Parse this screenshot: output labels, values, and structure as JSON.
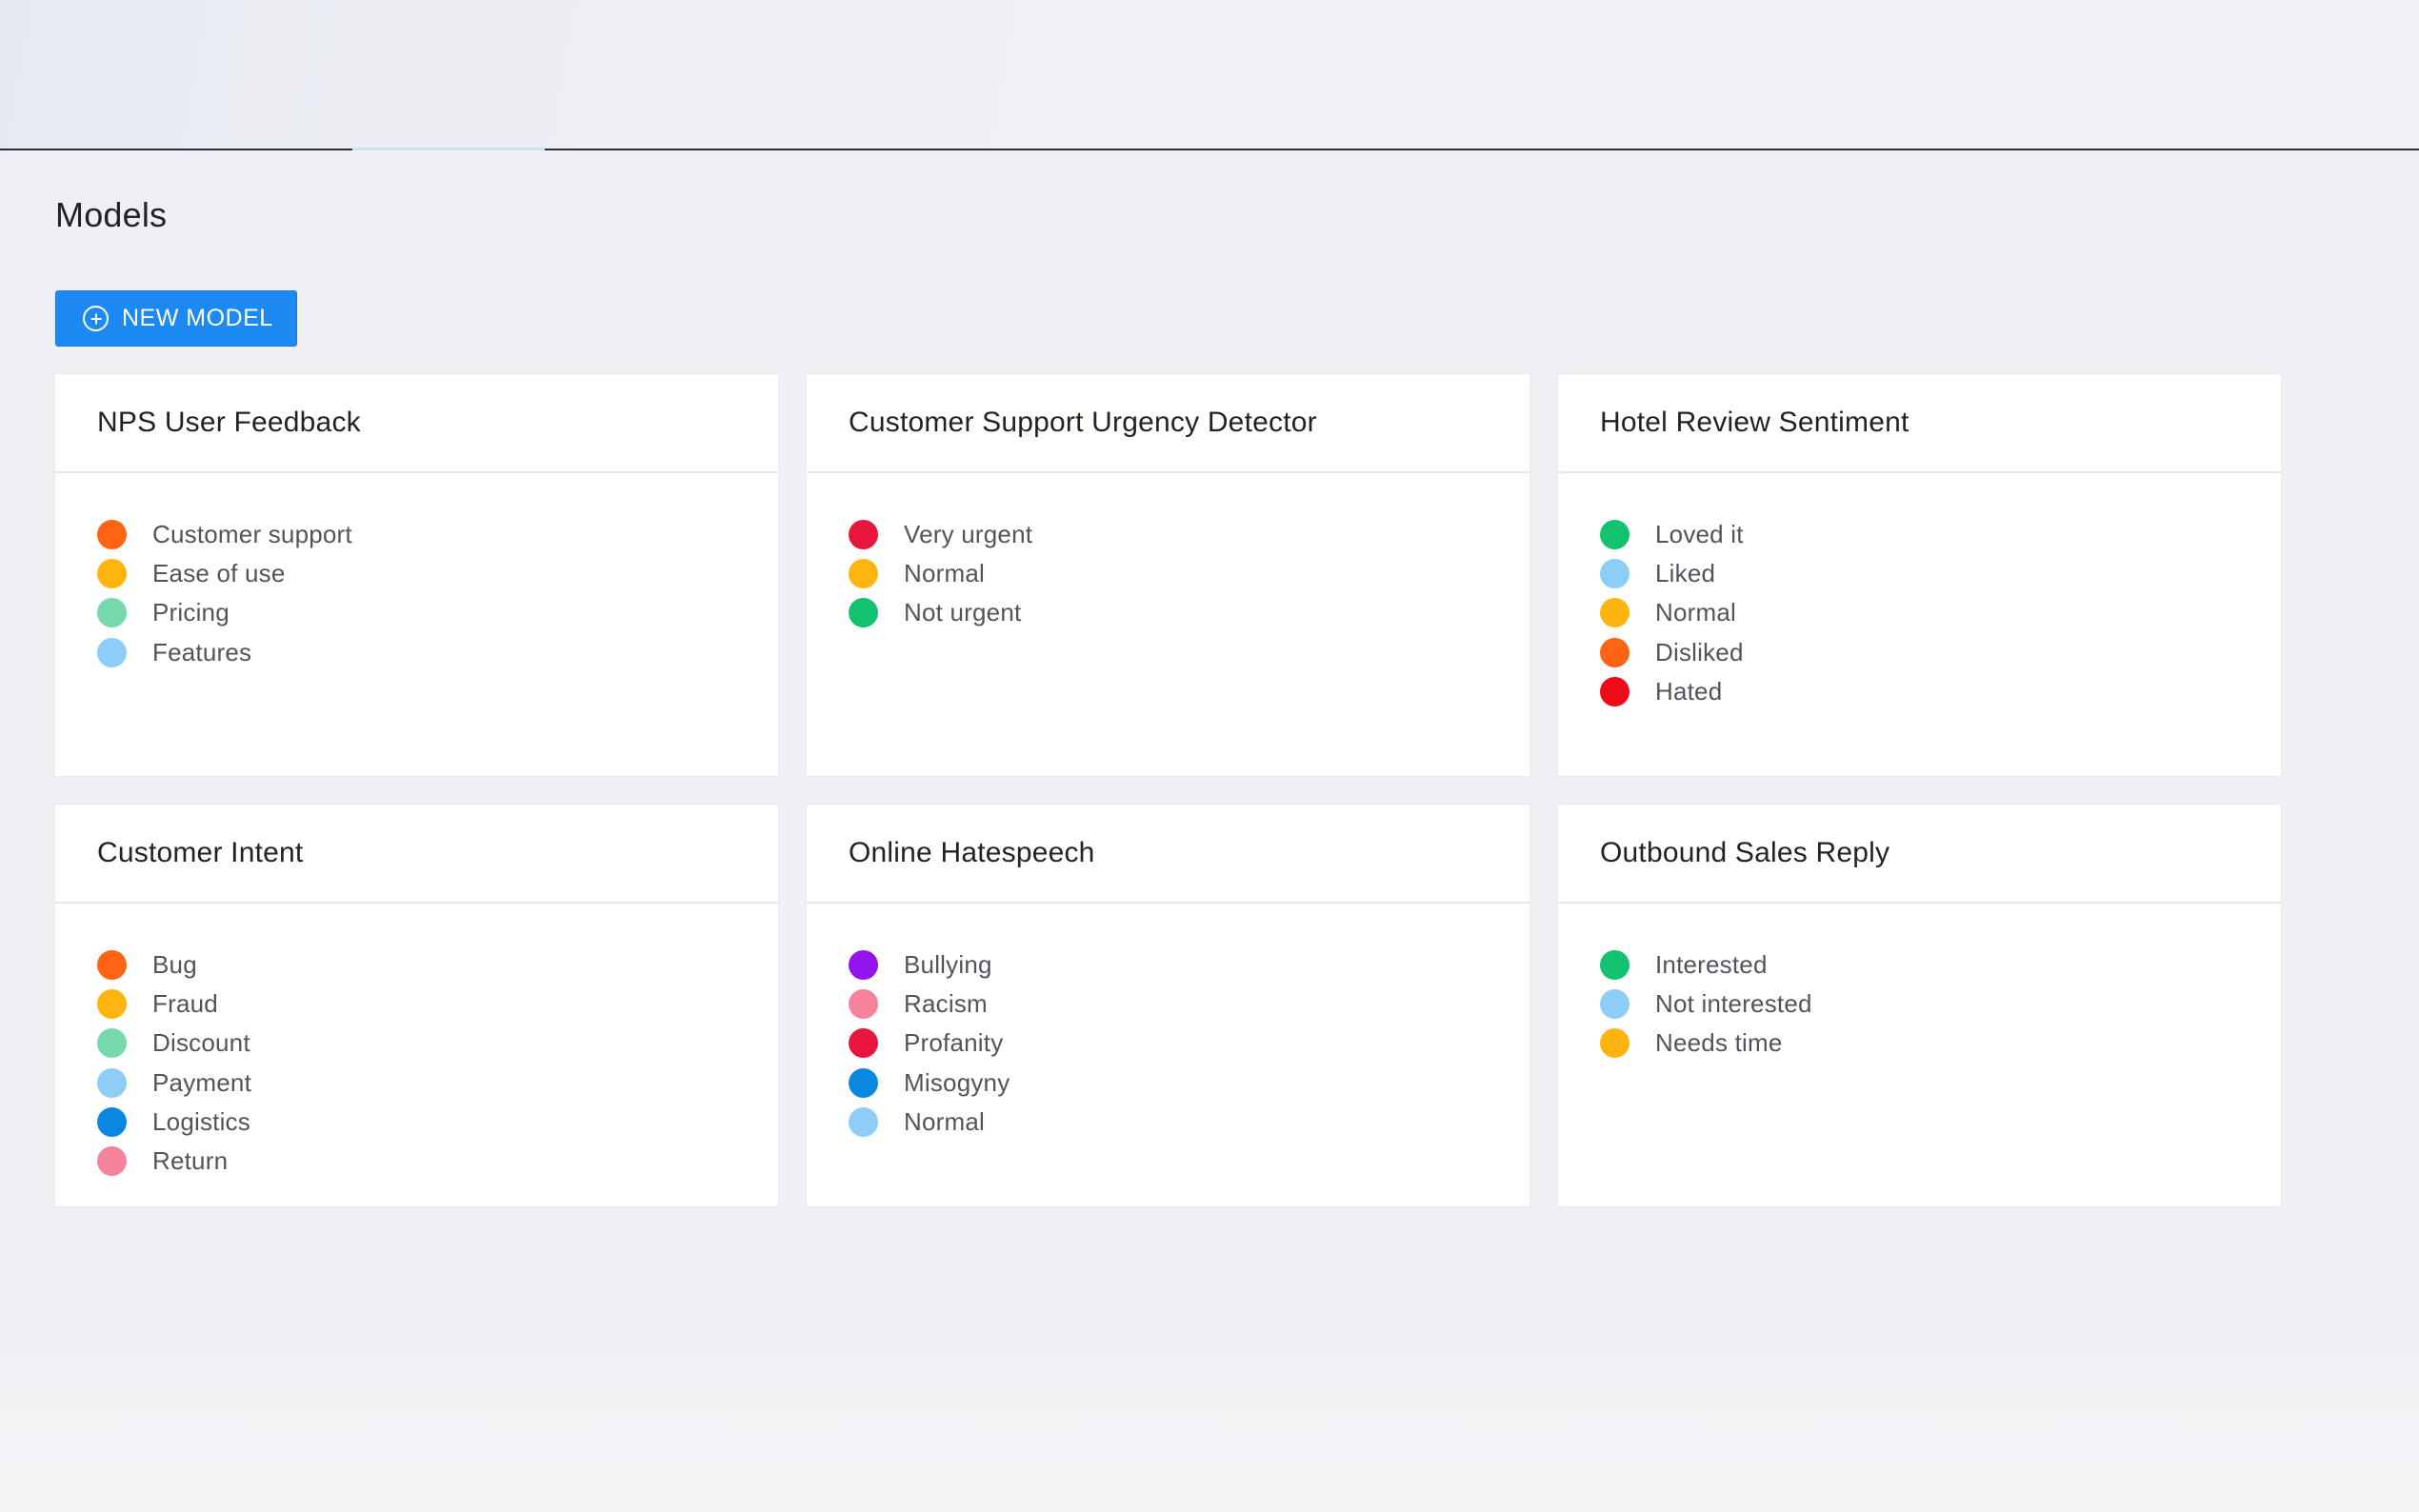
{
  "page": {
    "title": "Models",
    "new_button_label": "NEW MODEL"
  },
  "models": [
    {
      "title": "NPS User Feedback",
      "labels": [
        {
          "text": "Customer support",
          "color": "#ff6314"
        },
        {
          "text": "Ease of use",
          "color": "#ffb40f"
        },
        {
          "text": "Pricing",
          "color": "#75d9ab"
        },
        {
          "text": "Features",
          "color": "#8ecdf7"
        }
      ]
    },
    {
      "title": "Customer Support Urgency Detector",
      "labels": [
        {
          "text": "Very urgent",
          "color": "#e8163e"
        },
        {
          "text": "Normal",
          "color": "#ffb40f"
        },
        {
          "text": "Not urgent",
          "color": "#13c26e"
        }
      ]
    },
    {
      "title": "Hotel Review Sentiment",
      "labels": [
        {
          "text": "Loved it",
          "color": "#13c26e"
        },
        {
          "text": "Liked",
          "color": "#8ecdf7"
        },
        {
          "text": "Normal",
          "color": "#ffb40f"
        },
        {
          "text": "Disliked",
          "color": "#ff6314"
        },
        {
          "text": "Hated",
          "color": "#ef0a17"
        }
      ]
    },
    {
      "title": "Customer Intent",
      "labels": [
        {
          "text": "Bug",
          "color": "#ff6314"
        },
        {
          "text": "Fraud",
          "color": "#ffb40f"
        },
        {
          "text": "Discount",
          "color": "#75d9ab"
        },
        {
          "text": "Payment",
          "color": "#8ecdf7"
        },
        {
          "text": "Logistics",
          "color": "#0a87df"
        },
        {
          "text": "Return",
          "color": "#f6829b"
        }
      ]
    },
    {
      "title": "Online Hatespeech",
      "labels": [
        {
          "text": "Bullying",
          "color": "#9213ec"
        },
        {
          "text": "Racism",
          "color": "#f6829b"
        },
        {
          "text": "Profanity",
          "color": "#e8163e"
        },
        {
          "text": "Misogyny",
          "color": "#0a87df"
        },
        {
          "text": "Normal",
          "color": "#8ecdf7"
        }
      ]
    },
    {
      "title": "Outbound Sales Reply",
      "labels": [
        {
          "text": "Interested",
          "color": "#13c26e"
        },
        {
          "text": "Not interested",
          "color": "#8ecdf7"
        },
        {
          "text": "Needs time",
          "color": "#ffb40f"
        }
      ]
    }
  ],
  "icons": {
    "new_button_icon": "plus-circle-icon"
  }
}
